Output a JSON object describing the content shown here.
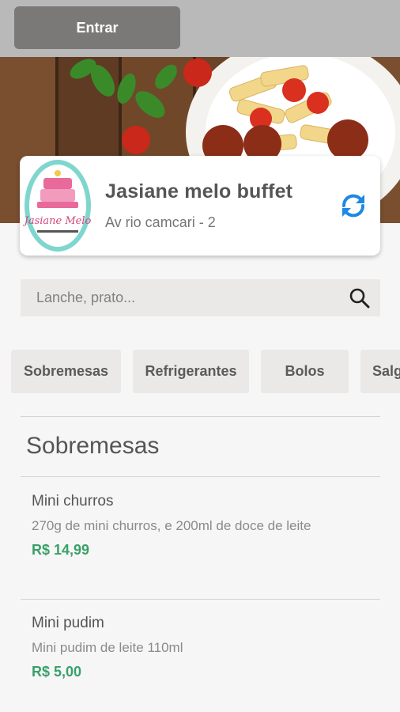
{
  "header": {
    "login_label": "Entrar"
  },
  "store": {
    "name": "Jasiane melo buffet",
    "address": "Av rio camcari - 2",
    "logo_text": "Jasiane Melo"
  },
  "search": {
    "placeholder": "Lanche, prato..."
  },
  "categories": [
    {
      "label": "Sobremesas"
    },
    {
      "label": "Refrigerantes"
    },
    {
      "label": "Bolos"
    },
    {
      "label": "Salg"
    }
  ],
  "section": {
    "title": "Sobremesas",
    "items": [
      {
        "name": "Mini churros",
        "description": "270g de mini churros, e 200ml de doce de leite",
        "price": "R$ 14,99"
      },
      {
        "name": "Mini pudim",
        "description": "Mini pudim de leite 110ml",
        "price": "R$ 5,00"
      }
    ]
  },
  "colors": {
    "price": "#38a169",
    "accent": "#1e88e5",
    "topbar": "#b9b9b9"
  },
  "icons": {
    "refresh": "refresh-icon",
    "search": "search-icon"
  }
}
